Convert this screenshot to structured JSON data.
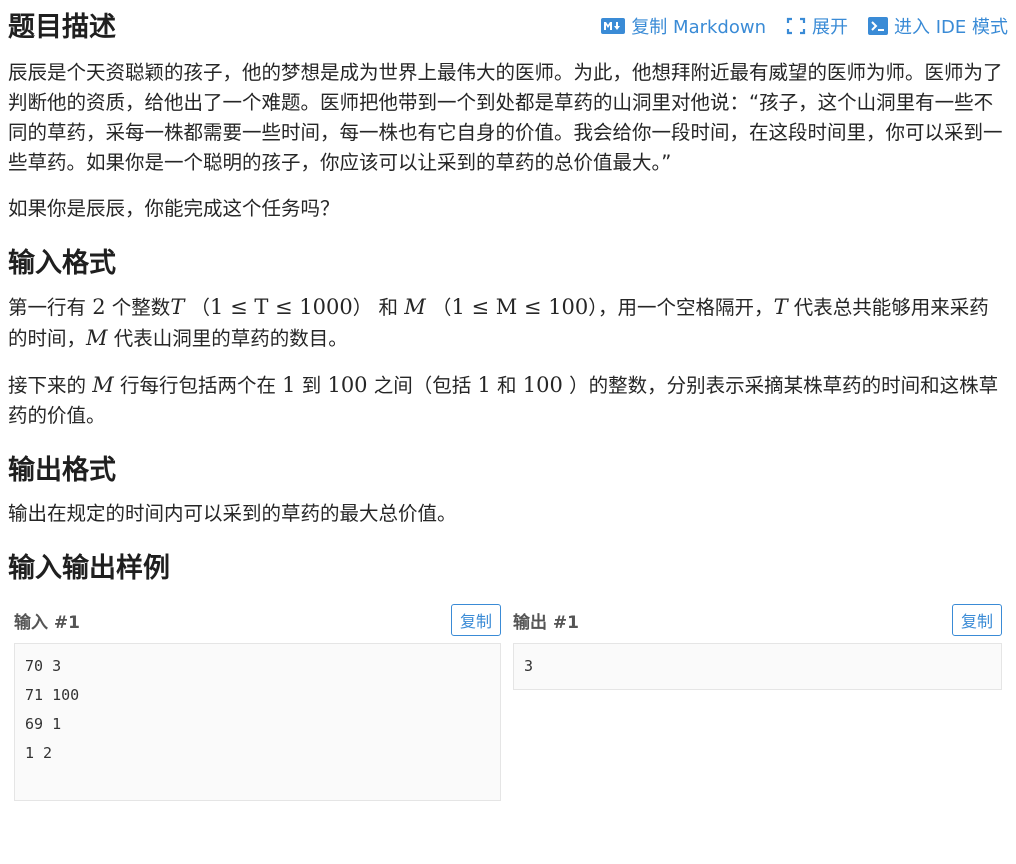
{
  "toolbar": {
    "copy_markdown": "复制 Markdown",
    "expand": "展开",
    "ide_mode": "进入 IDE 模式",
    "accent": "#3a8bd6"
  },
  "description": {
    "title": "题目描述",
    "para1": "辰辰是个天资聪颖的孩子，他的梦想是成为世界上最伟大的医师。为此，他想拜附近最有威望的医师为师。医师为了判断他的资质，给他出了一个难题。医师把他带到一个到处都是草药的山洞里对他说：“孩子，这个山洞里有一些不同的草药，采每一株都需要一些时间，每一株也有它自身的价值。我会给你一段时间，在这段时间里，你可以采到一些草药。如果你是一个聪明的孩子，你应该可以让采到的草药的总价值最大。”",
    "para2": "如果你是辰辰，你能完成这个任务吗？"
  },
  "input_format": {
    "title": "输入格式",
    "p1_a": "第一行有",
    "p1_num": "2",
    "p1_b": "个整数",
    "p1_T": "T",
    "p1_T_range_pre": "（",
    "p1_T_range": "1 ≤ T ≤ 1000",
    "p1_T_range_post": "）",
    "p1_and": "和",
    "p1_M": "M",
    "p1_M_range_pre": "（",
    "p1_M_range": "1 ≤ M ≤ 100",
    "p1_M_range_post": "），",
    "p1_c": "用一个空格隔开，",
    "p1_T2": "T",
    "p1_d": "代表总共能够用来采药的时间，",
    "p1_M2": "M",
    "p1_e": "代表山洞里的草药的数目。",
    "p2_a": "接下来的",
    "p2_M": "M",
    "p2_b": "行每行包括两个在",
    "p2_n1": "1",
    "p2_c": "到",
    "p2_n2": "100",
    "p2_d": "之间（包括",
    "p2_n3": "1",
    "p2_e": "和",
    "p2_n4": "100",
    "p2_f": "）的整数，分别表示采摘某株草药的时间和这株草药的价值。"
  },
  "output_format": {
    "title": "输出格式",
    "p1": "输出在规定的时间内可以采到的草药的最大总价值。"
  },
  "samples": {
    "title": "输入输出样例",
    "input_title": "输入 #1",
    "output_title": "输出 #1",
    "copy_label": "复制",
    "input_text": "70 3\n71 100\n69 1\n1 2",
    "output_text": "3"
  }
}
